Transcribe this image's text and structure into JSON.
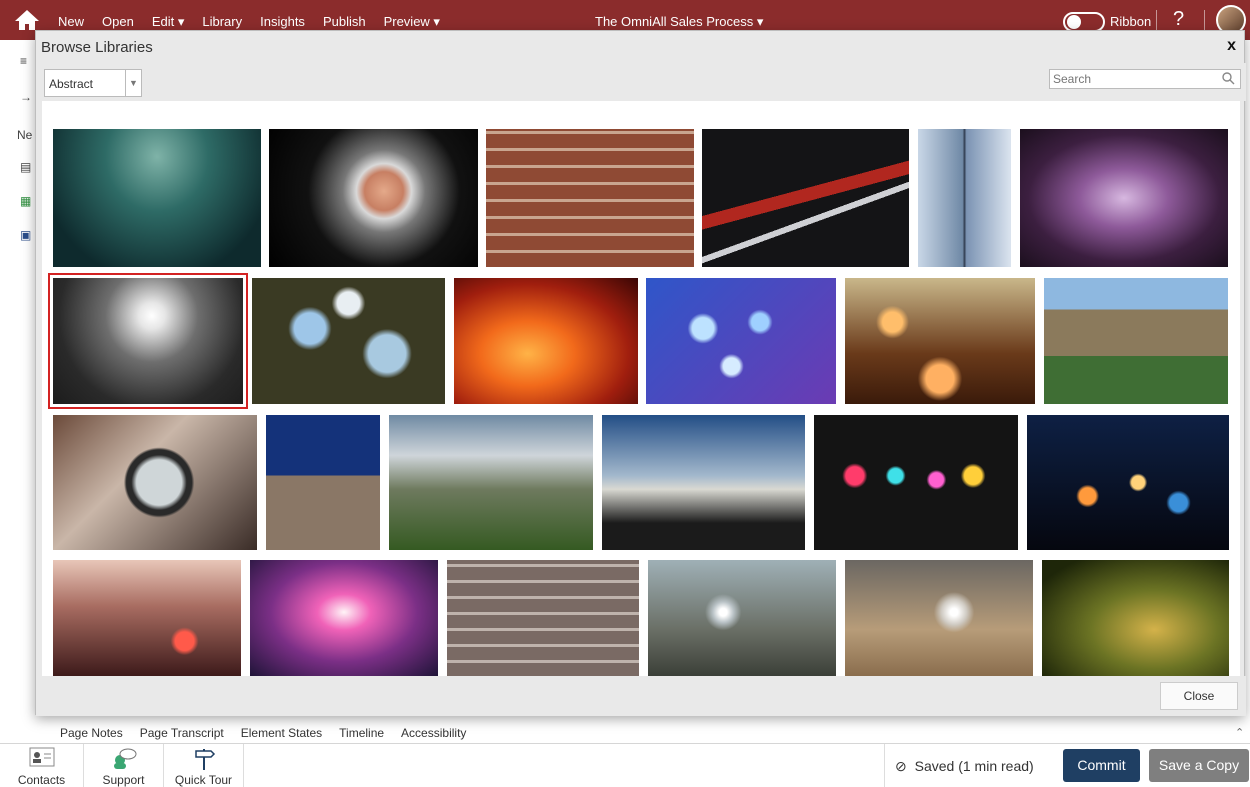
{
  "topbar": {
    "menu": [
      "New",
      "Open",
      "Edit ▾",
      "Library",
      "Insights",
      "Publish",
      "Preview ▾"
    ],
    "document_title": "The OmniAll Sales Process ▾",
    "ribbon_label": "Ribbon",
    "help": "?"
  },
  "left_rail": {
    "label": "Ne"
  },
  "modal": {
    "title": "Browse Libraries",
    "close_x": "x",
    "category": "Abstract",
    "search_placeholder": "Search",
    "close_button": "Close",
    "images": [
      {
        "subject": "teal-blur"
      },
      {
        "subject": "fist-through-glass"
      },
      {
        "subject": "brick-wall"
      },
      {
        "subject": "dry-branch-red-cloth"
      },
      {
        "subject": "mirror-sky"
      },
      {
        "subject": "purple-glow"
      },
      {
        "subject": "white-light-flare",
        "selected": true
      },
      {
        "subject": "green-bokeh"
      },
      {
        "subject": "fire"
      },
      {
        "subject": "blue-bokeh"
      },
      {
        "subject": "warm-bokeh"
      },
      {
        "subject": "university-building"
      },
      {
        "subject": "magnifying-glass"
      },
      {
        "subject": "star-trails"
      },
      {
        "subject": "blurred-field"
      },
      {
        "subject": "cloudy-sky"
      },
      {
        "subject": "colorful-bokeh"
      },
      {
        "subject": "night-city-bokeh"
      },
      {
        "subject": "red-lights-blur"
      },
      {
        "subject": "pink-haze"
      },
      {
        "subject": "cracked-brick"
      },
      {
        "subject": "broken-glass-trees"
      },
      {
        "subject": "broken-glass-wood"
      },
      {
        "subject": "green-grass"
      }
    ]
  },
  "tabs": [
    "Page Notes",
    "Page Transcript",
    "Element States",
    "Timeline",
    "Accessibility"
  ],
  "bottom": {
    "contacts": "Contacts",
    "support": "Support",
    "quick_tour": "Quick Tour",
    "saved_status": "Saved (1 min read)",
    "commit": "Commit",
    "save_copy": "Save a Copy"
  }
}
